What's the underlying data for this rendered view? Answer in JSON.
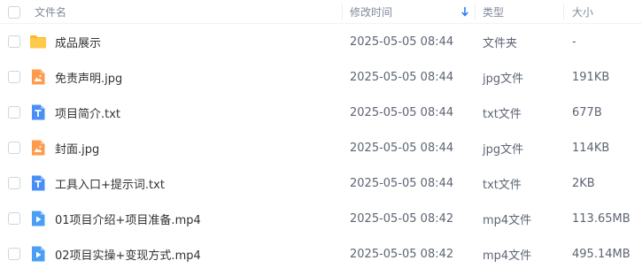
{
  "columns": {
    "name": "文件名",
    "modified": "修改时间",
    "type": "类型",
    "size": "大小"
  },
  "icons": {
    "header_checkbox": "checkbox-icon",
    "sort": "sort-down-arrow-icon",
    "folder": "folder-icon",
    "image": "image-file-icon",
    "text": "text-file-icon",
    "video": "video-file-icon"
  },
  "colors": {
    "folder": "#ffc23d",
    "image": "#ff9b4d",
    "text": "#4a8ff7",
    "video": "#4a9ff5",
    "sort_arrow": "#2f7bf5"
  },
  "files": [
    {
      "name": "成品展示",
      "modified": "2025-05-05 08:44",
      "type": "文件夹",
      "size": "-",
      "icon": "folder"
    },
    {
      "name": "免责声明.jpg",
      "modified": "2025-05-05 08:44",
      "type": "jpg文件",
      "size": "191KB",
      "icon": "image"
    },
    {
      "name": "项目简介.txt",
      "modified": "2025-05-05 08:44",
      "type": "txt文件",
      "size": "677B",
      "icon": "text"
    },
    {
      "name": "封面.jpg",
      "modified": "2025-05-05 08:44",
      "type": "jpg文件",
      "size": "114KB",
      "icon": "image"
    },
    {
      "name": "工具入口+提示词.txt",
      "modified": "2025-05-05 08:44",
      "type": "txt文件",
      "size": "2KB",
      "icon": "text"
    },
    {
      "name": "01项目介绍+项目准备.mp4",
      "modified": "2025-05-05 08:42",
      "type": "mp4文件",
      "size": "113.65MB",
      "icon": "video"
    },
    {
      "name": "02项目实操+变现方式.mp4",
      "modified": "2025-05-05 08:42",
      "type": "mp4文件",
      "size": "495.14MB",
      "icon": "video"
    }
  ]
}
